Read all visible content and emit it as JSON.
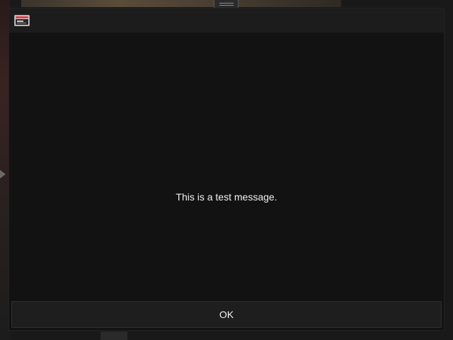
{
  "dialog": {
    "icon": "app-window-icon",
    "message": "This is a test message.",
    "ok_label": "OK"
  },
  "colors": {
    "dialog_background": "#121212",
    "titlebar_background": "#1c1c1c",
    "button_background": "#1e1e1e",
    "text": "#f0f0f0",
    "icon_accent": "#e0404a"
  }
}
